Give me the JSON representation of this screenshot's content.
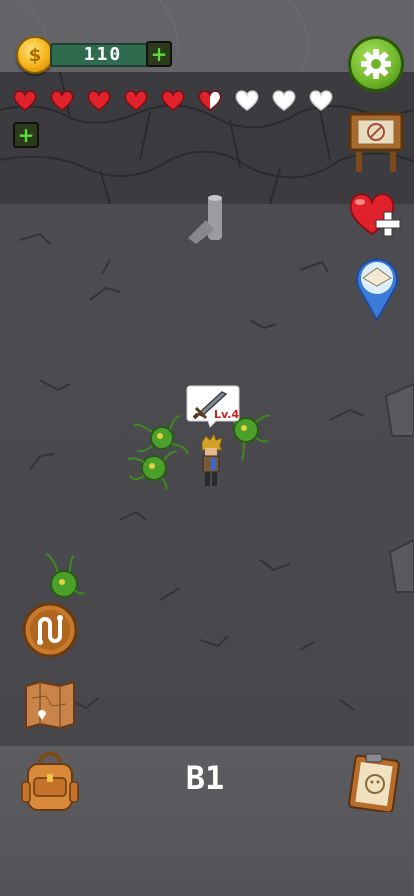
{
  "hud": {
    "coins": "110",
    "add_coins_glyph": "+",
    "add_health_glyph": "+",
    "settings_icon": "gear-icon",
    "hearts": [
      "full",
      "full",
      "full",
      "full",
      "full",
      "half",
      "empty",
      "empty",
      "empty"
    ],
    "colors": {
      "heart_full": "#e0222c",
      "heart_empty": "#ffffff",
      "accent_green": "#6fb52a"
    }
  },
  "player": {
    "level": "Lv.4",
    "weapon_icon": "sword-icon"
  },
  "floor": "B1",
  "right_buttons": [
    "quest-sign",
    "heal",
    "waypoint"
  ],
  "left_buttons": [
    "route",
    "map"
  ],
  "bottom_buttons": [
    "backpack",
    "notes"
  ]
}
